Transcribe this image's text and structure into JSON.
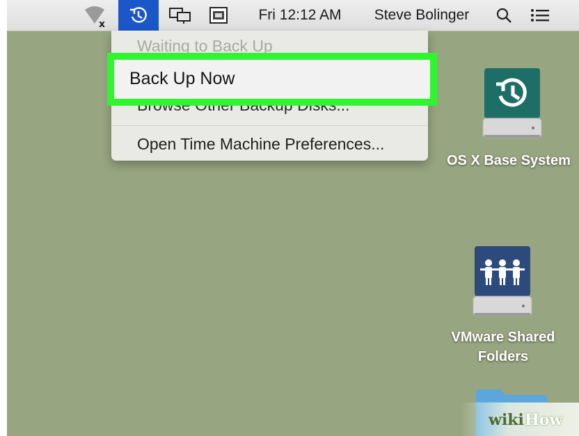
{
  "menubar": {
    "clock": "Fri 12:12 AM",
    "user": "Steve Bolinger",
    "icons": [
      "network-disconnected-icon",
      "time-machine-icon",
      "displays-icon",
      "keyboard-icon",
      "spotlight-search-icon",
      "notification-center-icon"
    ]
  },
  "time_machine_menu": {
    "status": "Waiting to Back Up",
    "back_up_now": "Back Up Now",
    "browse_disks_partial": "Browse Other Backup Disks...",
    "open_preferences": "Open Time Machine Preferences..."
  },
  "desktop": {
    "icons": [
      {
        "label": "OS X Base System",
        "icon": "time-machine-disk-icon"
      },
      {
        "label_line1": "VMware Shared",
        "label_line2": "Folders",
        "icon": "shared-folders-disk-icon"
      },
      {
        "icon": "folder-icon"
      }
    ]
  },
  "watermark": {
    "wiki": "wiki",
    "how": "How"
  },
  "colors": {
    "desktop": "#97a581",
    "menubar": "#e6e6e6",
    "active_menu": "#1b57c9",
    "highlight_border": "#2ff52f",
    "teal_disk": "#1e6e68",
    "blue_disk": "#2c4a7c"
  }
}
